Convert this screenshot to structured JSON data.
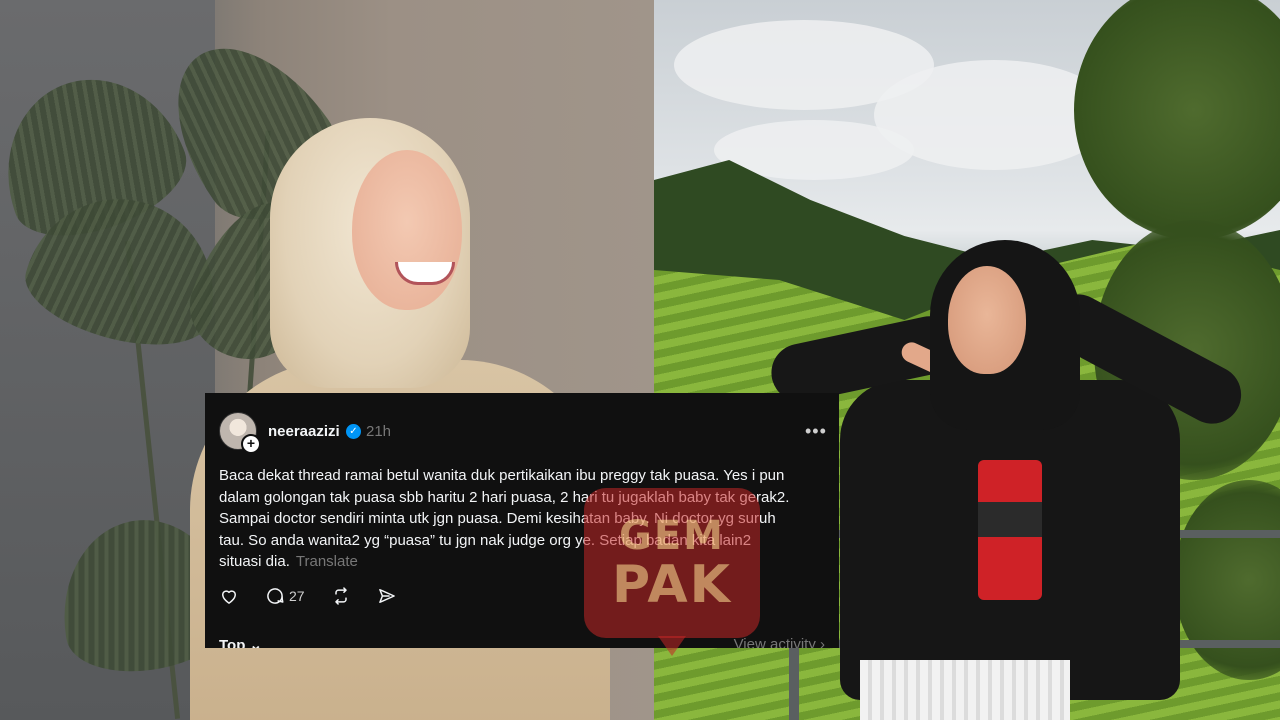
{
  "post": {
    "username": "neeraazizi",
    "verified_icon": "check-badge-icon",
    "timestamp": "21h",
    "more_icon": "•••",
    "lines": [
      "Baca dekat thread ramai betul wanita duk pertikaikan ibu preggy tak puasa. Yes i pun",
      "dalam golongan tak puasa sbb haritu 2 hari puasa, 2 hari tu jugaklah baby tak gerak2.",
      "Sampai doctor sendiri minta utk jgn puasa. Demi kesihatan baby. Ni doctor yg suruh",
      "tau. So anda wanita2 yg “puasa” tu jgn nak judge org ye. Setiap badan kita lain2",
      "situasi dia."
    ],
    "translate_label": "Translate",
    "actions": {
      "like_icon": "heart-icon",
      "reply_icon": "comment-icon",
      "reply_count": "27",
      "repost_icon": "repost-icon",
      "share_icon": "send-icon"
    },
    "sort_label": "Top ⌄",
    "view_activity_label": "View activity ›"
  },
  "watermark": {
    "line1": "GEM",
    "line2": "PAK"
  },
  "colors": {
    "card_bg": "#101010",
    "text_primary": "#f3f5f7",
    "text_secondary": "#777777",
    "verified_blue": "#0095f6",
    "watermark_red": "#c42626"
  }
}
